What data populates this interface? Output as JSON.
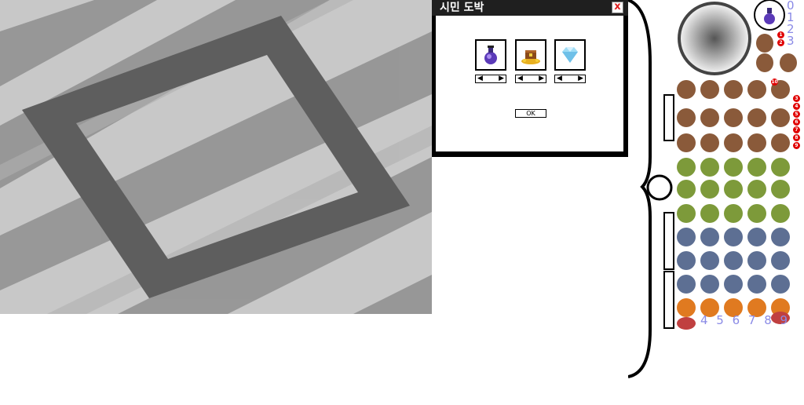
{
  "dialog": {
    "title": "시민 도박",
    "close_symbol": "x",
    "ok_label": "OK",
    "left_arrow": "◀",
    "right_arrow": "▶",
    "slots": [
      "potion-icon",
      "treasure-chest-icon",
      "diamond-icon"
    ]
  },
  "sprite_counter_digits": [
    "0",
    "1",
    "2",
    "3"
  ],
  "bottom_digits": "4 5 6 7 8 9",
  "badges": [
    "1",
    "2",
    "3",
    "4",
    "5",
    "6",
    "7",
    "8",
    "9",
    "10"
  ],
  "colors": {
    "terrain_light": "#c8c8c8",
    "terrain_dark": "#8f8f8f",
    "frame": "#5e5e5e",
    "titlebar": "#1f1f1f",
    "close_x": "#e02020",
    "digits": "#8a8ae6",
    "badge": "#e00000"
  }
}
